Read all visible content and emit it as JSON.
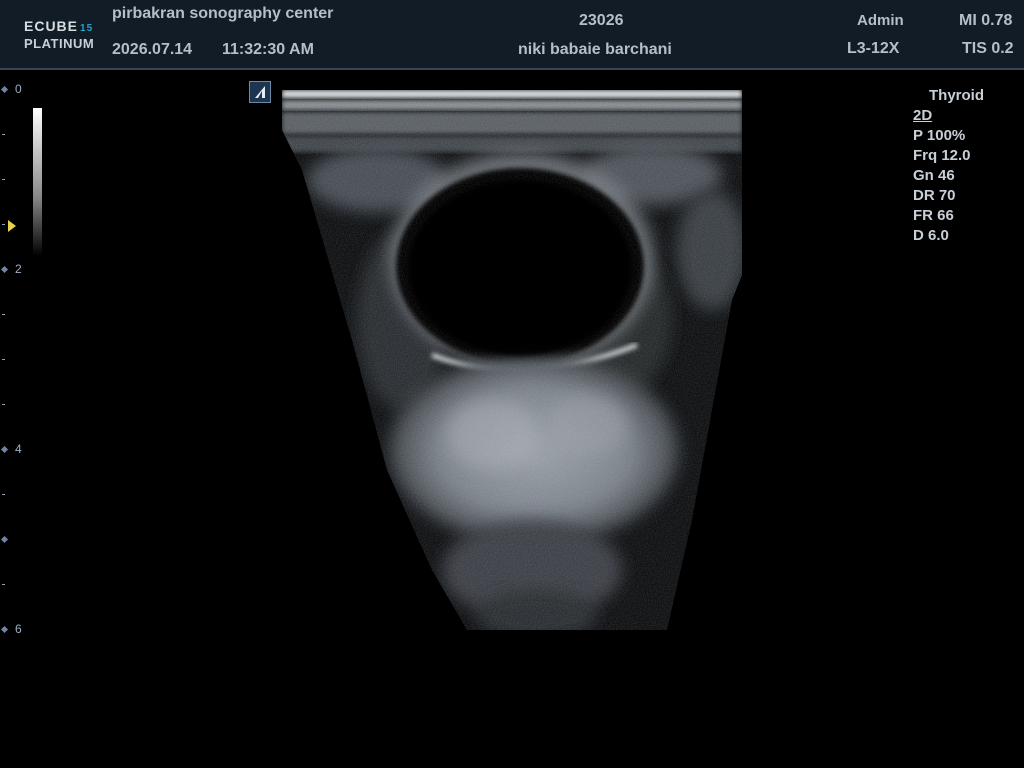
{
  "header": {
    "logo": {
      "brand": "ECUBE",
      "model_number": "15",
      "edition": "PLATINUM"
    },
    "center_name": "pirbakran sonography center",
    "date": "2026.07.14",
    "time": "11:32:30  AM",
    "patient_id": "23026",
    "patient_name": "niki babaie barchani",
    "user": "Admin",
    "probe": "L3-12X",
    "mi": "MI 0.78",
    "tis": "TIS 0.2"
  },
  "depth_scale": {
    "labels": [
      "0",
      "2",
      "4",
      "6"
    ]
  },
  "parameters": {
    "preset": "Thyroid",
    "mode": "2D",
    "power": "P 100%",
    "frequency": "Frq 12.0",
    "gain": "Gn 46",
    "dynamic_range": "DR 70",
    "frame_rate": "FR 66",
    "depth": "D 6.0"
  },
  "colors": {
    "header_bg": "#121c26",
    "header_text": "#b4bfca",
    "focus_marker": "#e8d24a",
    "logo_accent": "#1fa3c9"
  },
  "icons": {
    "orientation": "orientation-marker-icon",
    "focus": "focus-marker-icon"
  }
}
